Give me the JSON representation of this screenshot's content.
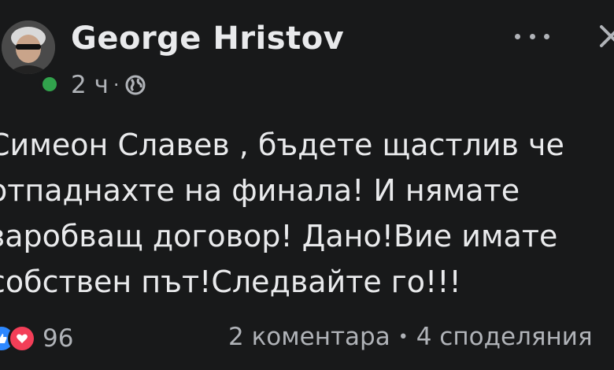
{
  "post": {
    "author": "George Hristov",
    "time": "2 ч",
    "meta_separator": "·",
    "visibility_icon": "globe-icon",
    "text_lines": [
      "Симеон Славев , бъдете щастлив че",
      "отпаднахте на финала! И нямате",
      "заробващ договор! Дано!Вие имате",
      "собствен път!Следвайте го!!!"
    ]
  },
  "footer": {
    "reaction_icons": [
      "like-icon",
      "love-icon"
    ],
    "reaction_count": "96",
    "comments": "2 коментара",
    "separator": "•",
    "shares": "4 споделяния"
  },
  "colors": {
    "background": "#18191a",
    "text": "#e9eaec",
    "secondary": "#b0b3b8",
    "online": "#31a24c",
    "like": "#2d88ff",
    "love": "#f33e58"
  }
}
